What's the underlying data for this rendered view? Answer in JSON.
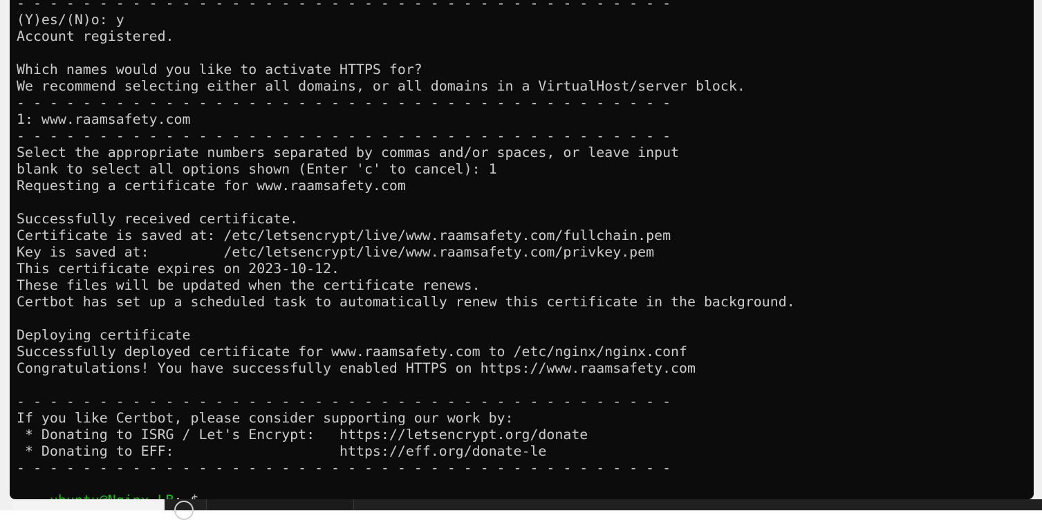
{
  "terminal": {
    "lines": [
      "- - - - - - - - - - - - - - - - - - - - - - - - - - - - - - - - - - - - - - - -",
      "(Y)es/(N)o: y",
      "Account registered.",
      "",
      "Which names would you like to activate HTTPS for?",
      "We recommend selecting either all domains, or all domains in a VirtualHost/server block.",
      "- - - - - - - - - - - - - - - - - - - - - - - - - - - - - - - - - - - - - - - -",
      "1: www.raamsafety.com",
      "- - - - - - - - - - - - - - - - - - - - - - - - - - - - - - - - - - - - - - - -",
      "Select the appropriate numbers separated by commas and/or spaces, or leave input",
      "blank to select all options shown (Enter 'c' to cancel): 1",
      "Requesting a certificate for www.raamsafety.com",
      "",
      "Successfully received certificate.",
      "Certificate is saved at: /etc/letsencrypt/live/www.raamsafety.com/fullchain.pem",
      "Key is saved at:         /etc/letsencrypt/live/www.raamsafety.com/privkey.pem",
      "This certificate expires on 2023-10-12.",
      "These files will be updated when the certificate renews.",
      "Certbot has set up a scheduled task to automatically renew this certificate in the background.",
      "",
      "Deploying certificate",
      "Successfully deployed certificate for www.raamsafety.com to /etc/nginx/nginx.conf",
      "Congratulations! You have successfully enabled HTTPS on https://www.raamsafety.com",
      "",
      "- - - - - - - - - - - - - - - - - - - - - - - - - - - - - - - - - - - - - - - -",
      "If you like Certbot, please consider supporting our work by:",
      " * Donating to ISRG / Let's Encrypt:   https://letsencrypt.org/donate",
      " * Donating to EFF:                    https://eff.org/donate-le",
      "- - - - - - - - - - - - - - - - - - - - - - - - - - - - - - - - - - - - - - - -"
    ],
    "prompt": {
      "user_host": "ubuntu@Nginx-LB",
      "colon": ":",
      "path": "~",
      "symbol": "$"
    }
  },
  "colors": {
    "background": "#0c0c0c",
    "foreground": "#cccccc",
    "prompt_user": "#16c60c",
    "prompt_path": "#3b78ff"
  }
}
